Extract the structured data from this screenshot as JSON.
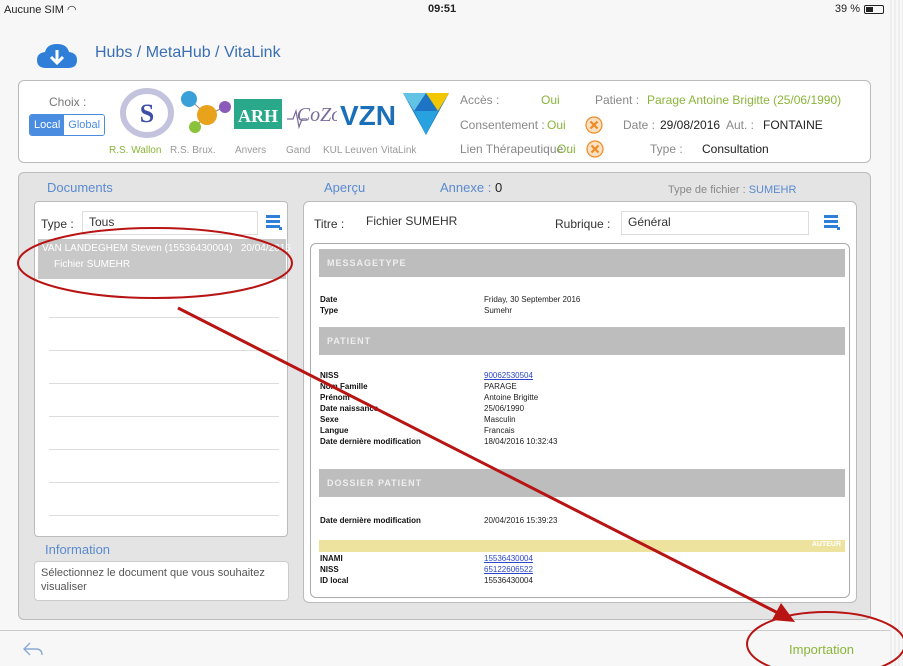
{
  "status_bar": {
    "carrier": "Aucune SIM",
    "time": "09:51",
    "battery": "39 %"
  },
  "header": {
    "title": "Hubs / MetaHub / VitaLink"
  },
  "hub_selection": {
    "choix_label": "Choix :",
    "scope_options": [
      "Local",
      "Global"
    ],
    "hub_names": [
      "R.S. Wallon",
      "R.S. Brux.",
      "Anvers",
      "Gand",
      "KUL Leuven",
      "VitaLink"
    ],
    "logo_texts": {
      "arh": "ARH",
      "cozo": "CoZo",
      "vzn": "VZN"
    }
  },
  "access": {
    "acces_label": "Accès :",
    "acces_value": "Oui",
    "consent_label": "Consentement :",
    "consent_value": "Oui",
    "lien_label": "Lien Thérapeutique :",
    "lien_value": "Oui",
    "patient_label": "Patient :",
    "patient_value": "Parage Antoine Brigitte (25/06/1990)",
    "date_label": "Date :",
    "date_value": "29/08/2016",
    "aut_label": "Aut. :",
    "aut_value": "FONTAINE",
    "type_label": "Type :",
    "type_value": "Consultation"
  },
  "documents": {
    "heading": "Documents",
    "type_label": "Type :",
    "type_value": "Tous",
    "items": [
      {
        "title": "VAN LANDEGHEM Steven (15536430004)",
        "date": "20/04/2016",
        "subtitle": "Fichier SUMEHR"
      }
    ]
  },
  "information": {
    "heading": "Information",
    "text": "Sélectionnez le document que vous souhaitez visualiser"
  },
  "preview": {
    "apercu_label": "Aperçu",
    "annexe_label": "Annexe :",
    "annexe_count": "0",
    "file_type_label": "Type de fichier :",
    "file_type_value": "SUMEHR",
    "titre_label": "Titre :",
    "titre_value": "Fichier SUMEHR",
    "rubrique_label": "Rubrique :",
    "rubrique_value": "Général"
  },
  "document_view": {
    "messagetype_heading": "MESSAGETYPE",
    "messagetype_rows": [
      {
        "key": "Date",
        "value": "Friday, 30 September 2016"
      },
      {
        "key": "Type",
        "value": "Sumehr"
      }
    ],
    "patient_heading": "PATIENT",
    "patient_rows": [
      {
        "key": "NISS",
        "value": "90062530504"
      },
      {
        "key": "Nom Famille",
        "value": "PARAGE"
      },
      {
        "key": "Prénom",
        "value": "Antoine Brigitte"
      },
      {
        "key": "Date naissance",
        "value": "25/06/1990"
      },
      {
        "key": "Sexe",
        "value": "Masculin"
      },
      {
        "key": "Langue",
        "value": "Francais"
      },
      {
        "key": "Date dernière modification",
        "value": "18/04/2016 10:32:43"
      }
    ],
    "dossier_heading": "DOSSIER PATIENT",
    "dossier_rows": [
      {
        "key": "Date dernière modification",
        "value": "20/04/2016 15:39:23"
      }
    ],
    "auteur_heading": "AUTEUR",
    "auteur_rows": [
      {
        "key": "INAMI",
        "value": "15536430004"
      },
      {
        "key": "NISS",
        "value": "65122606522"
      },
      {
        "key": "ID local",
        "value": "15536430004"
      }
    ]
  },
  "bottom_bar": {
    "import_label": "Importation"
  },
  "colors": {
    "accent_blue": "#4a8de0",
    "accent_green": "#8ab53a",
    "annotation_red": "#b81414",
    "warning_orange": "#f08a24"
  }
}
